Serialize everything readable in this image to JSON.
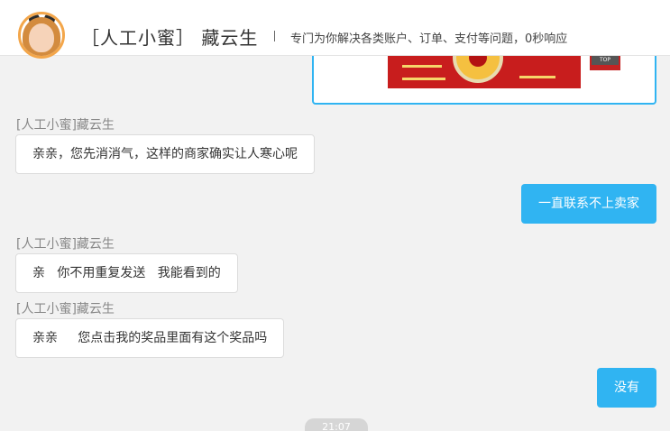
{
  "header": {
    "agent_title": "［人工小蜜］ 藏云生",
    "separator": "|",
    "description": "专门为你解决各类账户、订单、支付等问题，0秒响应"
  },
  "messages": [
    {
      "side": "left",
      "sender": "[人工小蜜]藏云生",
      "text": "亲亲，您先消消气，这样的商家确实让人寒心呢"
    },
    {
      "side": "right",
      "text": "一直联系不上卖家"
    },
    {
      "side": "left",
      "sender": "[人工小蜜]藏云生",
      "text": "亲   你不用重复发送   我能看到的"
    },
    {
      "side": "left",
      "sender": "[人工小蜜]藏云生",
      "text": "亲亲     您点击我的奖品里面有这个奖品吗"
    },
    {
      "side": "right",
      "text": "没有"
    }
  ],
  "image_message": {
    "side_tag": "TOP"
  },
  "timestamp": "21:07",
  "colors": {
    "accent": "#30b4f2",
    "background": "#f2f2f2",
    "avatar_ring": "#f3a64a"
  }
}
